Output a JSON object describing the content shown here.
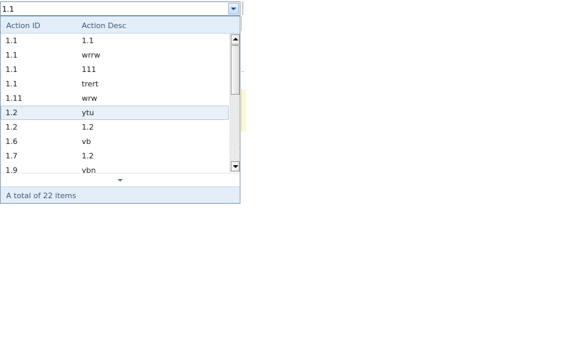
{
  "combo": {
    "value": "1.1"
  },
  "dropdown": {
    "columns": [
      "Action ID",
      "Action Desc"
    ],
    "rows": [
      {
        "id": "1.1",
        "desc": "1.1"
      },
      {
        "id": "1.1",
        "desc": "wrrw"
      },
      {
        "id": "1.1",
        "desc": "111"
      },
      {
        "id": "1.1",
        "desc": "trert"
      },
      {
        "id": "1.11",
        "desc": "wrw"
      },
      {
        "id": "1.2",
        "desc": "ytu"
      },
      {
        "id": "1.2",
        "desc": "1.2"
      },
      {
        "id": "1.6",
        "desc": "vb"
      },
      {
        "id": "1.7",
        "desc": "1.2"
      },
      {
        "id": "1.9",
        "desc": "vbn"
      }
    ],
    "selected_index": 5,
    "footer_text": "A total of 22 items"
  },
  "icons": {
    "dropdown": "chevron-down-icon",
    "scroll_up": "scroll-up-arrow-icon",
    "scroll_down": "scroll-down-arrow-icon",
    "load_more": "chevron-down-icon"
  },
  "colors": {
    "border": "#7f9db9",
    "header_bg": "#e4eef9",
    "header_text": "#3d5a7a",
    "selected_bg": "#e8f0fa"
  }
}
